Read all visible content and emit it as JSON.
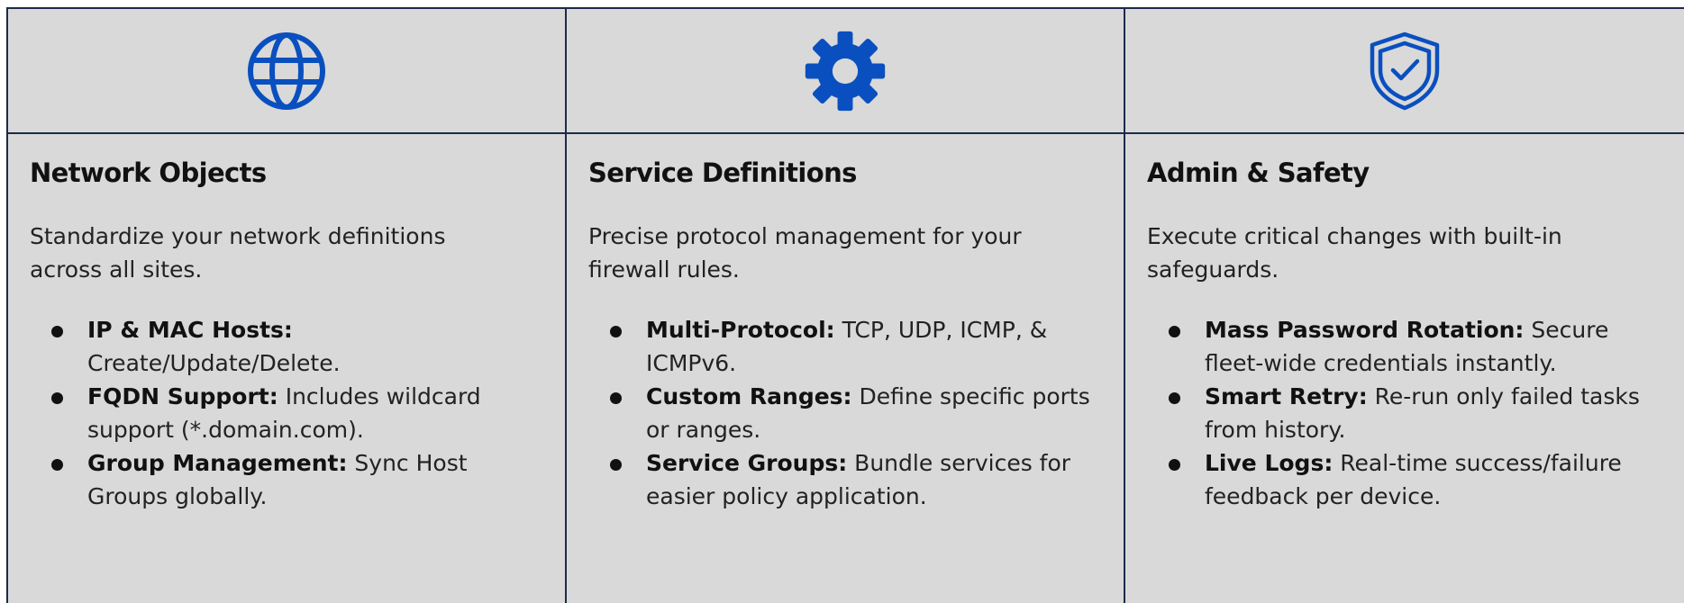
{
  "colors": {
    "background": "#d9d9d9",
    "border": "#1c2a4a",
    "icon_blue": "#0a4fbf",
    "text": "#222222"
  },
  "cards": [
    {
      "icon": "globe-icon",
      "title": "Network Objects",
      "description": "Standardize your network definitions across all sites.",
      "features": [
        {
          "label": "IP & MAC Hosts:",
          "text": " Create/Update/Delete."
        },
        {
          "label": "FQDN Support:",
          "text": " Includes wildcard support (*.domain.com)."
        },
        {
          "label": "Group Management:",
          "text": " Sync Host Groups globally."
        }
      ]
    },
    {
      "icon": "gear-icon",
      "title": "Service Definitions",
      "description": "Precise protocol management for your firewall rules.",
      "features": [
        {
          "label": "Multi-Protocol:",
          "text": " TCP, UDP, ICMP, & ICMPv6."
        },
        {
          "label": "Custom Ranges:",
          "text": " Define specific ports or ranges."
        },
        {
          "label": "Service Groups:",
          "text": " Bundle services for easier policy application."
        }
      ]
    },
    {
      "icon": "shield-check-icon",
      "title": "Admin & Safety",
      "description": "Execute critical changes with built-in safeguards.",
      "features": [
        {
          "label": "Mass Password Rotation:",
          "text": " Secure fleet-wide credentials instantly."
        },
        {
          "label": "Smart Retry:",
          "text": " Re-run only failed tasks from history."
        },
        {
          "label": "Live Logs:",
          "text": " Real-time success/failure feedback per device."
        }
      ]
    }
  ]
}
